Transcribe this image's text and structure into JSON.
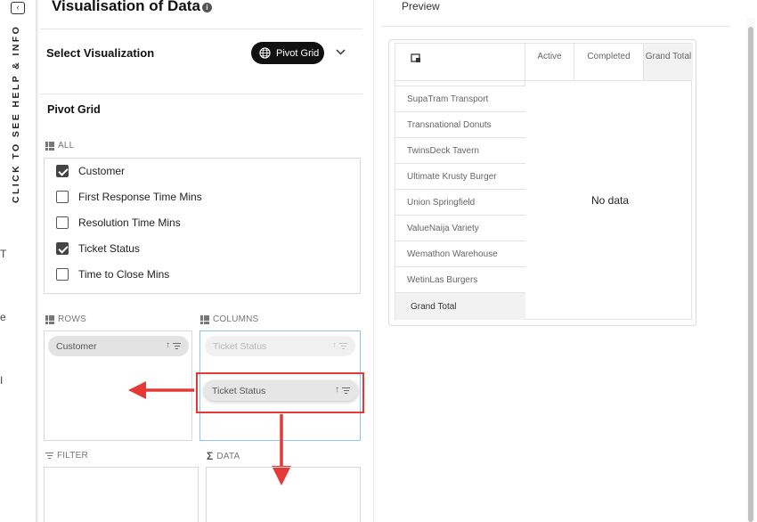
{
  "sidebar": {
    "help_text": "CLICK TO SEE HELP & INFO",
    "icon": "collapse-panel-icon",
    "edge_fragments": [
      "T",
      "e",
      "I"
    ]
  },
  "header": {
    "title": "Visualisation of Data",
    "info_icon": "info-icon"
  },
  "select_visualization": {
    "label": "Select Visualization",
    "selected": "Pivot Grid",
    "icon": "globe-icon"
  },
  "pivot_grid": {
    "heading": "Pivot Grid",
    "all_label": "ALL",
    "fields": [
      {
        "label": "Customer",
        "checked": true
      },
      {
        "label": "First Response Time Mins",
        "checked": false
      },
      {
        "label": "Resolution Time Mins",
        "checked": false
      },
      {
        "label": "Ticket Status",
        "checked": true
      },
      {
        "label": "Time to Close Mins",
        "checked": false
      }
    ],
    "rows": {
      "label": "ROWS",
      "chips": [
        "Customer"
      ]
    },
    "columns": {
      "label": "COLUMNS",
      "chips": [
        "Ticket Status"
      ],
      "dragging_chip": "Ticket Status"
    },
    "filter": {
      "label": "FILTER"
    },
    "data": {
      "label": "DATA"
    }
  },
  "preview": {
    "label": "Preview",
    "column_headers": [
      "Active",
      "Completed",
      "Grand Total"
    ],
    "row_headers": [
      "SupaTram Transport",
      "Transnational Donuts",
      "TwinsDeck Tavern",
      "Ultimate Krusty Burger",
      "Union Springfield",
      "ValueNaija Variety",
      "Wemathon Warehouse",
      "WetinLas Burgers",
      "Grand Total"
    ],
    "empty_message": "No data"
  },
  "colors": {
    "accent_dark": "#111111",
    "highlight": "#e53935",
    "columns_border": "#8ec5ee"
  }
}
